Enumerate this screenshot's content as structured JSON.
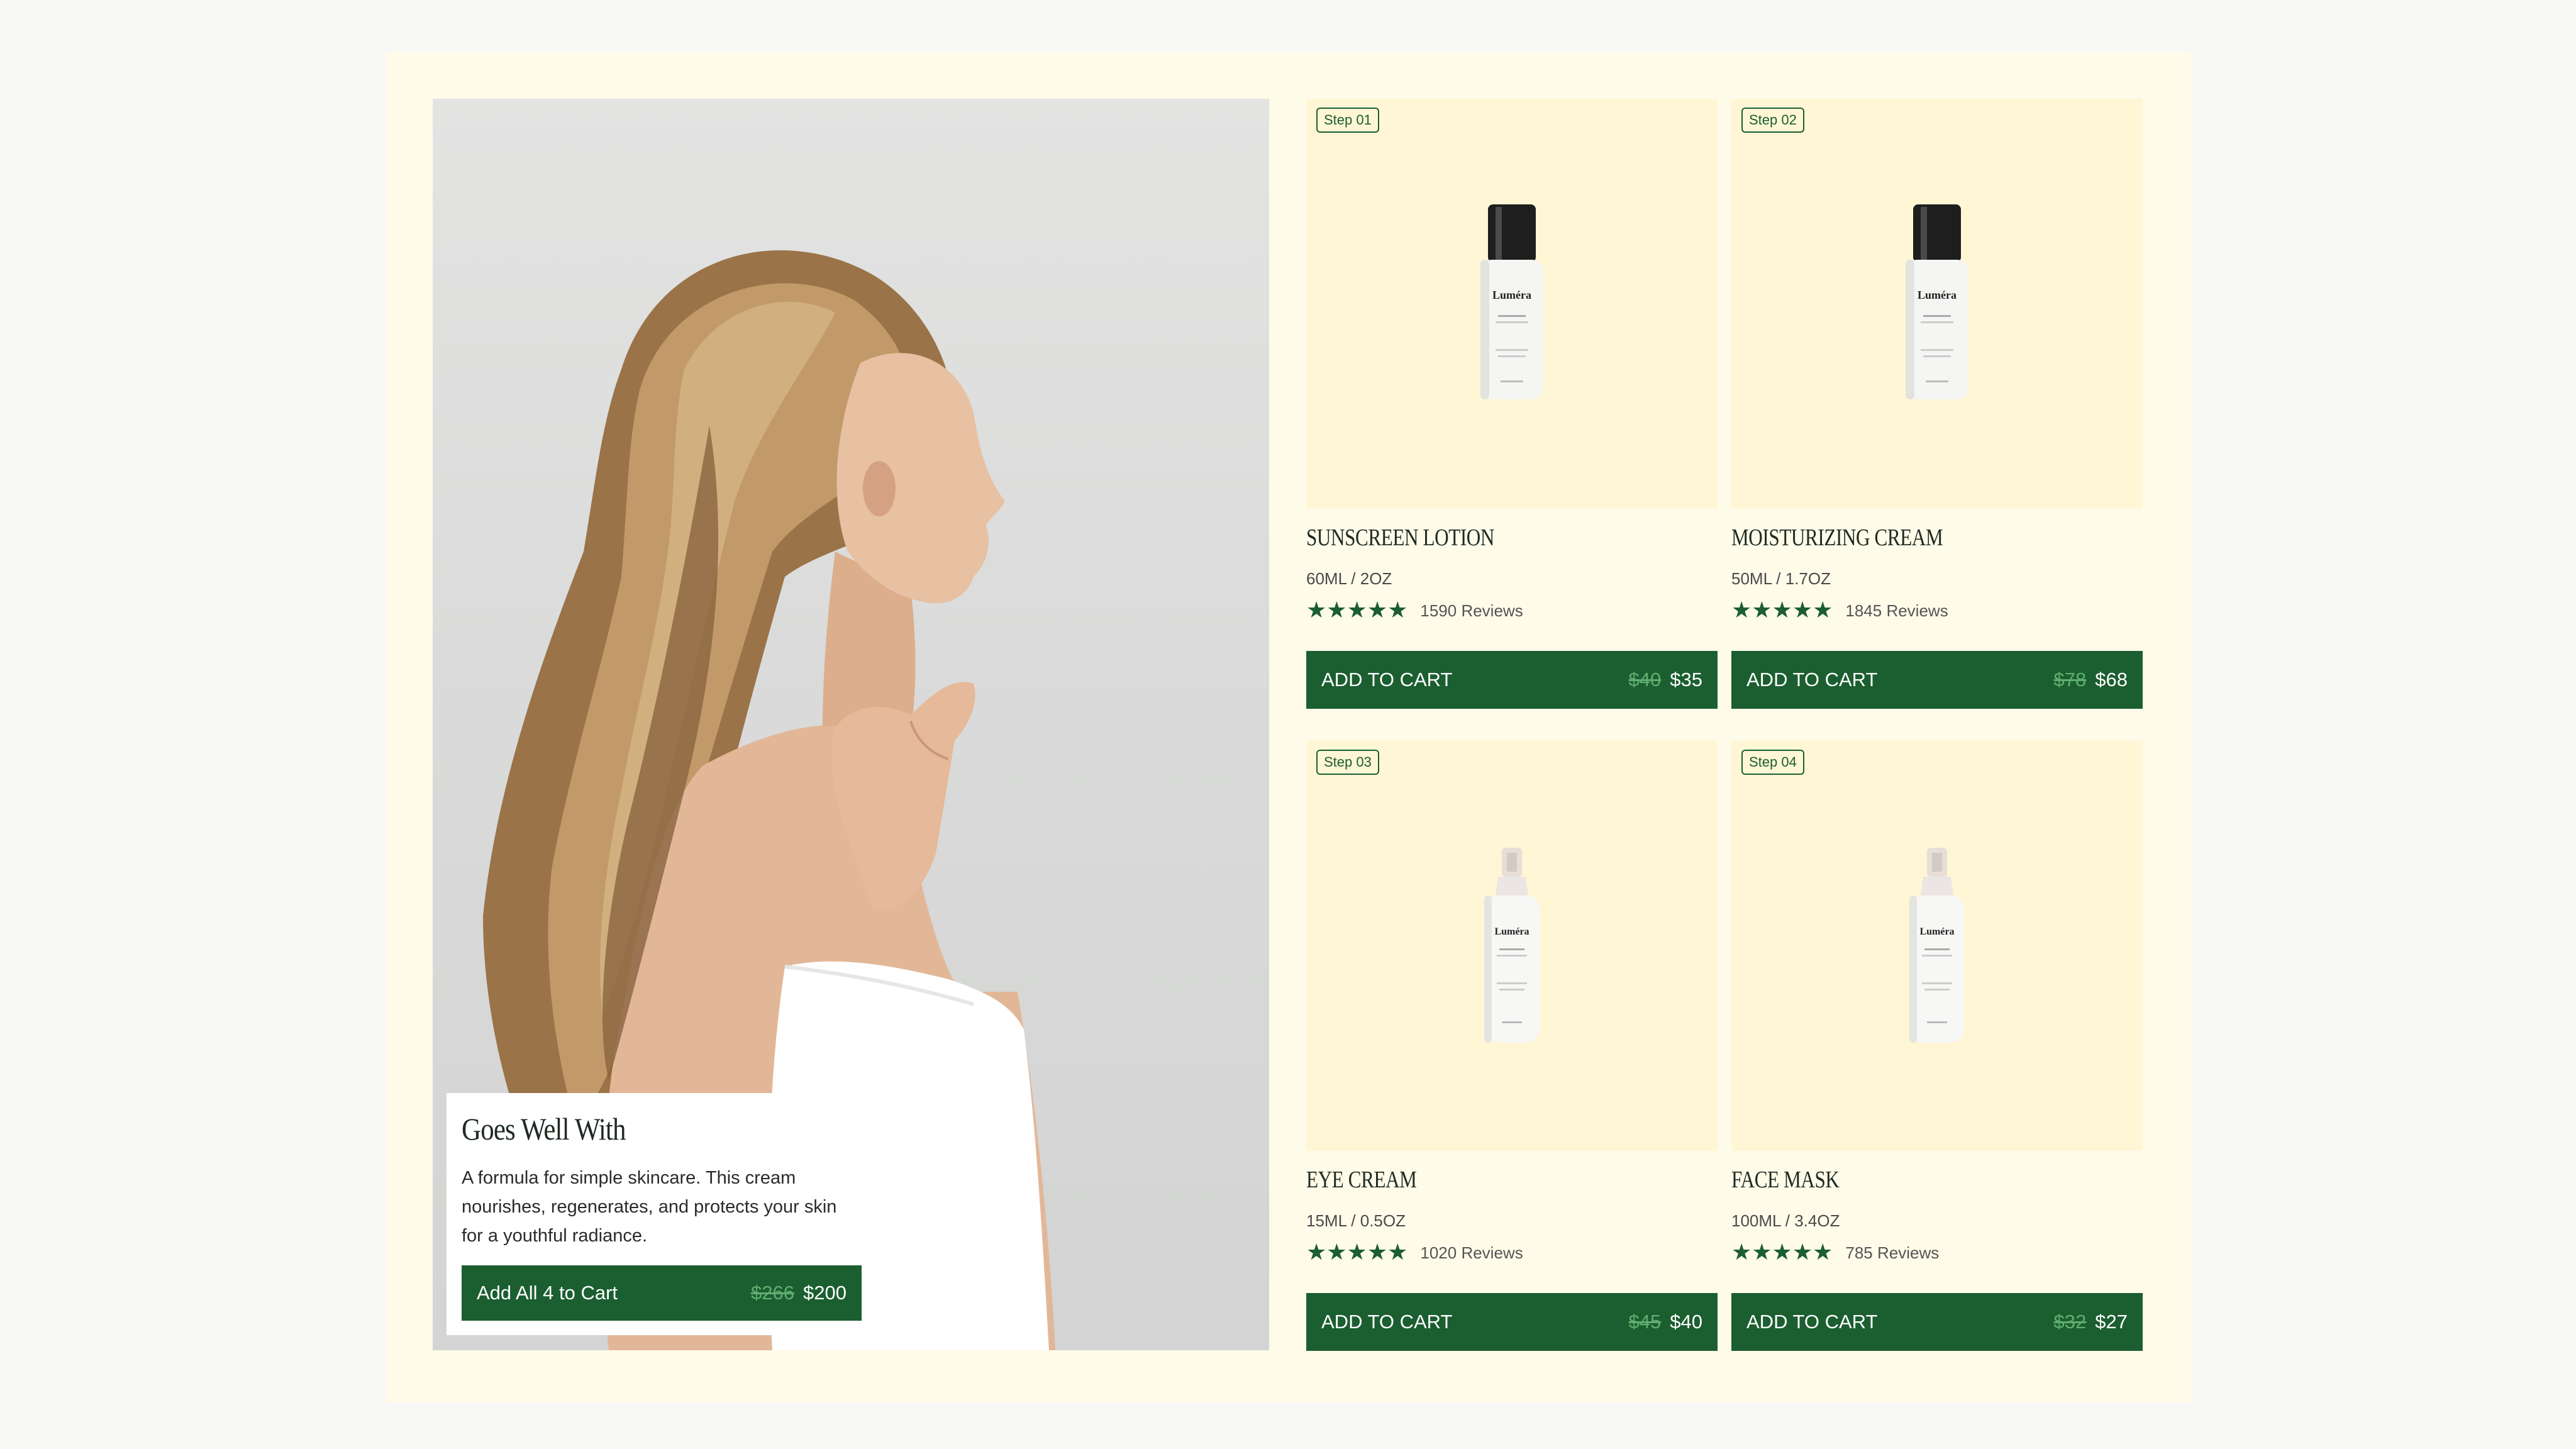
{
  "colors": {
    "accent": "#1b5e30",
    "card_bg": "#fff6d5",
    "page_bg": "#fffbe9",
    "old_price": "#5fae6f"
  },
  "hero": {
    "image_icon": "woman-profile-photo",
    "goes_well": {
      "title": "Goes Well With",
      "description": "A formula for simple skincare. This cream nourishes, regenerates, and protects your skin for a youthful radiance.",
      "button_label": "Add All 4 to Cart",
      "old_price": "$266",
      "price": "$200"
    }
  },
  "products": [
    {
      "step": "Step 01",
      "name": "SUNSCREEN LOTION",
      "size": "60ML / 2OZ",
      "stars": "★★★★★",
      "rating": 5,
      "reviews": "1590 Reviews",
      "button_label": "ADD TO CART",
      "old_price": "$40",
      "price": "$35",
      "image_icon": "pump-bottle-icon",
      "bottle_brand": "Luméra"
    },
    {
      "step": "Step 02",
      "name": "MOISTURIZING CREAM",
      "size": "50ML / 1.7OZ",
      "stars": "★★★★★",
      "rating": 5,
      "reviews": "1845 Reviews",
      "button_label": "ADD TO CART",
      "old_price": "$78",
      "price": "$68",
      "image_icon": "pump-bottle-icon",
      "bottle_brand": "Luméra"
    },
    {
      "step": "Step 03",
      "name": "EYE CREAM",
      "size": "15ML / 0.5OZ",
      "stars": "★★★★★",
      "rating": 5,
      "reviews": "1020 Reviews",
      "button_label": "ADD TO CART",
      "old_price": "$45",
      "price": "$40",
      "image_icon": "spray-bottle-icon",
      "bottle_brand": "Luméra"
    },
    {
      "step": "Step 04",
      "name": "FACE MASK",
      "size": "100ML / 3.4OZ",
      "stars": "★★★★★",
      "rating": 5,
      "reviews": "785 Reviews",
      "button_label": "ADD TO CART",
      "old_price": "$32",
      "price": "$27",
      "image_icon": "spray-bottle-icon",
      "bottle_brand": "Luméra"
    }
  ]
}
